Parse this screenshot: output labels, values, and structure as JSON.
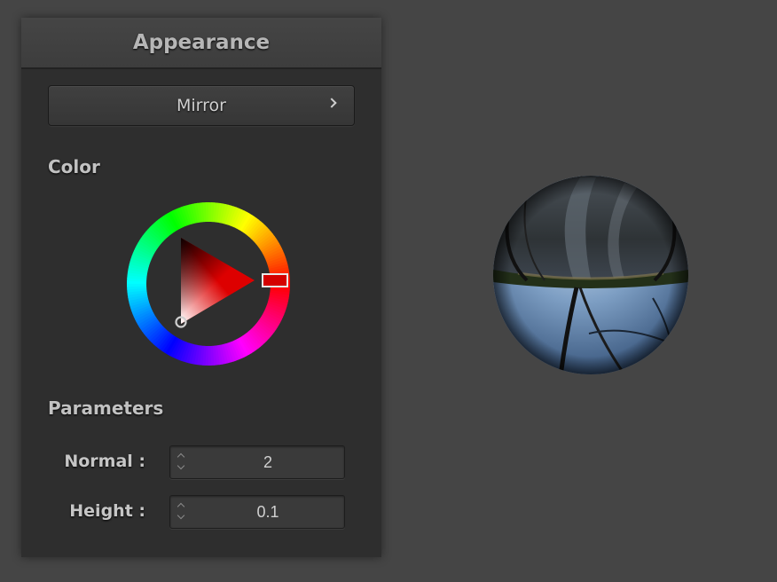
{
  "panel": {
    "title": "Appearance",
    "material_button": {
      "label": "Mirror",
      "icon": "chevron-right-icon"
    },
    "color_section": {
      "title": "Color",
      "selected_hue_color": "#ff0000"
    },
    "parameters_section": {
      "title": "Parameters",
      "fields": [
        {
          "label": "Normal :",
          "value": "2"
        },
        {
          "label": "Height :",
          "value": "0.1"
        }
      ]
    }
  },
  "colors": {
    "background": "#454545",
    "panel": "#2e2e2e",
    "header": "#424242",
    "text": "#c2c2c2"
  }
}
